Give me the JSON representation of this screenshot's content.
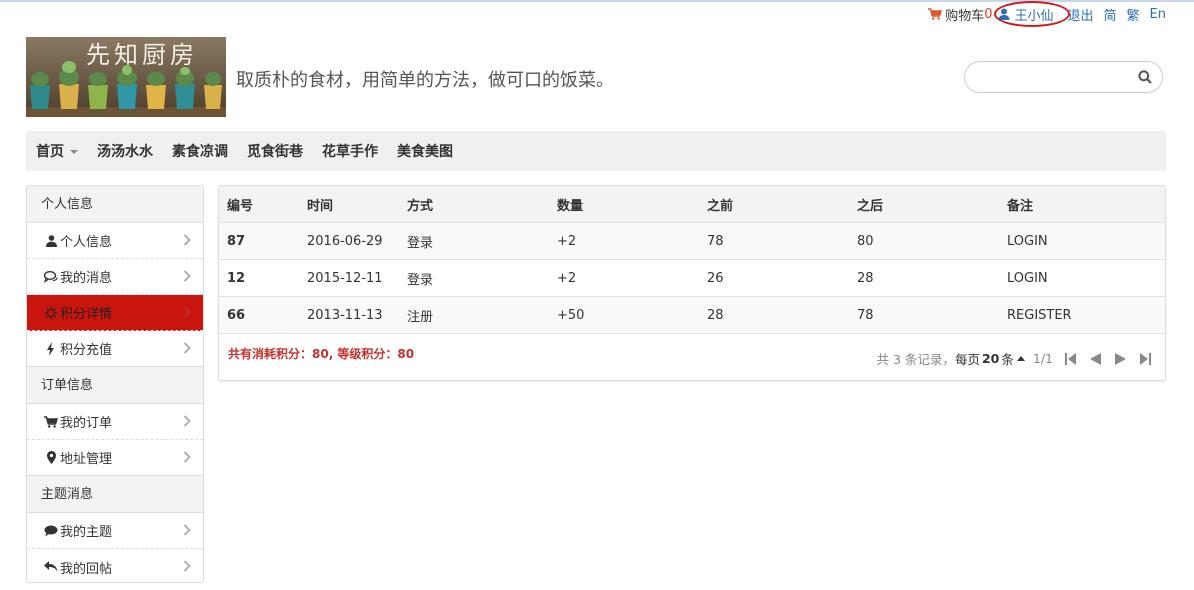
{
  "topbar": {
    "cart_label": "购物车",
    "cart_count": "0",
    "username": "王小仙",
    "logout": "退出",
    "lang_simplified": "简",
    "lang_traditional": "繁",
    "lang_english": "En"
  },
  "header": {
    "logo_text": "先知厨房",
    "slogan": "取质朴的食材，用简单的方法，做可口的饭菜。",
    "search_placeholder": ""
  },
  "nav": {
    "items": [
      {
        "label": "首页"
      },
      {
        "label": "汤汤水水"
      },
      {
        "label": "素食凉调"
      },
      {
        "label": "觅食街巷"
      },
      {
        "label": "花草手作"
      },
      {
        "label": "美食美图"
      }
    ]
  },
  "sidebar": {
    "group1": "个人信息",
    "profile": "个人信息",
    "messages": "我的消息",
    "points": "积分详情",
    "recharge": "积分充值",
    "group2": "订单信息",
    "orders": "我的订单",
    "address": "地址管理",
    "group3": "主题消息",
    "topics": "我的主题",
    "replies": "我的回帖"
  },
  "table": {
    "headers": [
      "编号",
      "时间",
      "方式",
      "数量",
      "之前",
      "之后",
      "备注"
    ],
    "rows": [
      [
        "87",
        "2016-06-29",
        "登录",
        "+2",
        "78",
        "80",
        "LOGIN"
      ],
      [
        "12",
        "2015-12-11",
        "登录",
        "+2",
        "26",
        "28",
        "LOGIN"
      ],
      [
        "66",
        "2013-11-13",
        "注册",
        "+50",
        "28",
        "78",
        "REGISTER"
      ]
    ]
  },
  "summary": "共有消耗积分：80, 等级积分：80",
  "pager": {
    "total_prefix": "共 3 条记录，",
    "per_page_label": "每页",
    "per_page_value": "20",
    "per_page_unit": "条",
    "page": "1/1"
  },
  "colors": {
    "accent_red": "#c9150e",
    "link_blue": "#2a6fba",
    "summary_red": "#c9302c"
  }
}
